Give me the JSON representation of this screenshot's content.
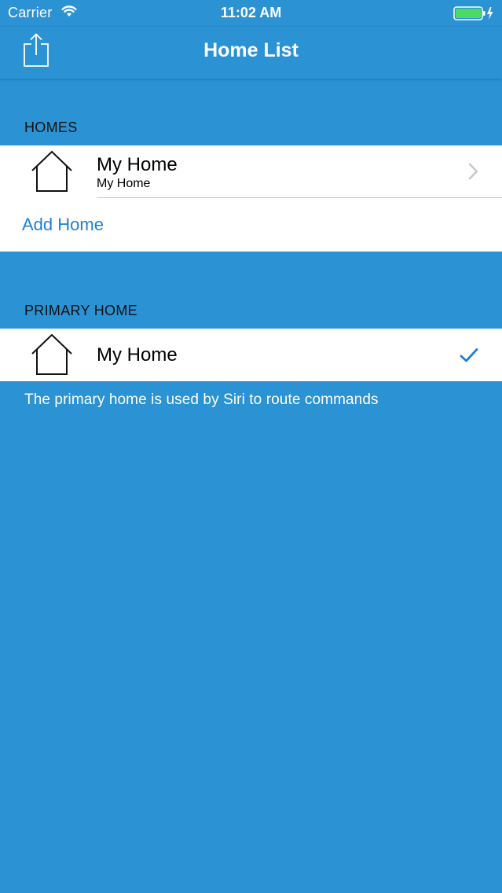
{
  "status_bar": {
    "carrier": "Carrier",
    "time": "11:02 AM",
    "battery_color": "#4cd964"
  },
  "nav_bar": {
    "title": "Home List",
    "left_icon": "share-icon"
  },
  "sections": {
    "homes": {
      "header": "HOMES",
      "items": [
        {
          "title": "My Home",
          "subtitle": "My Home",
          "icon": "house-icon",
          "accessory": "chevron-right-icon"
        }
      ],
      "add_label": "Add Home"
    },
    "primary": {
      "header": "PRIMARY HOME",
      "items": [
        {
          "title": "My Home",
          "icon": "house-icon",
          "accessory": "checkmark-icon"
        }
      ],
      "footer": "The primary home is used by Siri to route commands"
    }
  },
  "colors": {
    "background": "#2b92d4",
    "link": "#1f7fd6",
    "checkmark": "#1f7fd6",
    "cell_background": "#ffffff"
  }
}
